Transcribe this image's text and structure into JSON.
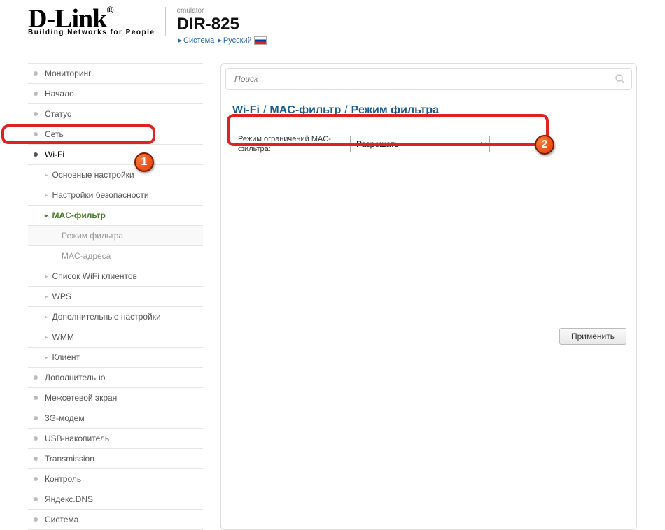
{
  "header": {
    "logo_main": "D-Link",
    "logo_tagline": "Building Networks for People",
    "emulator_label": "emulator",
    "model": "DIR-825",
    "bc_system": "Система",
    "bc_lang": "Русский"
  },
  "nav": {
    "monitoring": "Мониторинг",
    "start": "Начало",
    "status": "Статус",
    "network": "Сеть",
    "wifi": "Wi-Fi",
    "wifi_basic": "Основные настройки",
    "wifi_security": "Настройки безопасности",
    "wifi_mac_filter": "MAC-фильтр",
    "wifi_mac_filter_mode": "Режим фильтра",
    "wifi_mac_addresses": "MAC-адреса",
    "wifi_clients": "Список WiFi клиентов",
    "wifi_wps": "WPS",
    "wifi_advanced": "Дополнительные настройки",
    "wifi_wmm": "WMM",
    "wifi_client": "Клиент",
    "advanced": "Дополнительно",
    "firewall": "Межсетевой экран",
    "modem3g": "3G-модем",
    "usb": "USB-накопитель",
    "transmission": "Transmission",
    "control": "Контроль",
    "yandexdns": "Яндекс.DNS",
    "system": "Система"
  },
  "search": {
    "placeholder": "Поиск"
  },
  "breadcrumb": {
    "a": "Wi-Fi",
    "b": "MAC-фильтр",
    "c": "Режим фильтра"
  },
  "form": {
    "mode_label": "Режим ограничений MAC-фильтра:",
    "mode_value": "Разрешать"
  },
  "buttons": {
    "apply": "Применить"
  },
  "callouts": {
    "one": "1",
    "two": "2"
  }
}
